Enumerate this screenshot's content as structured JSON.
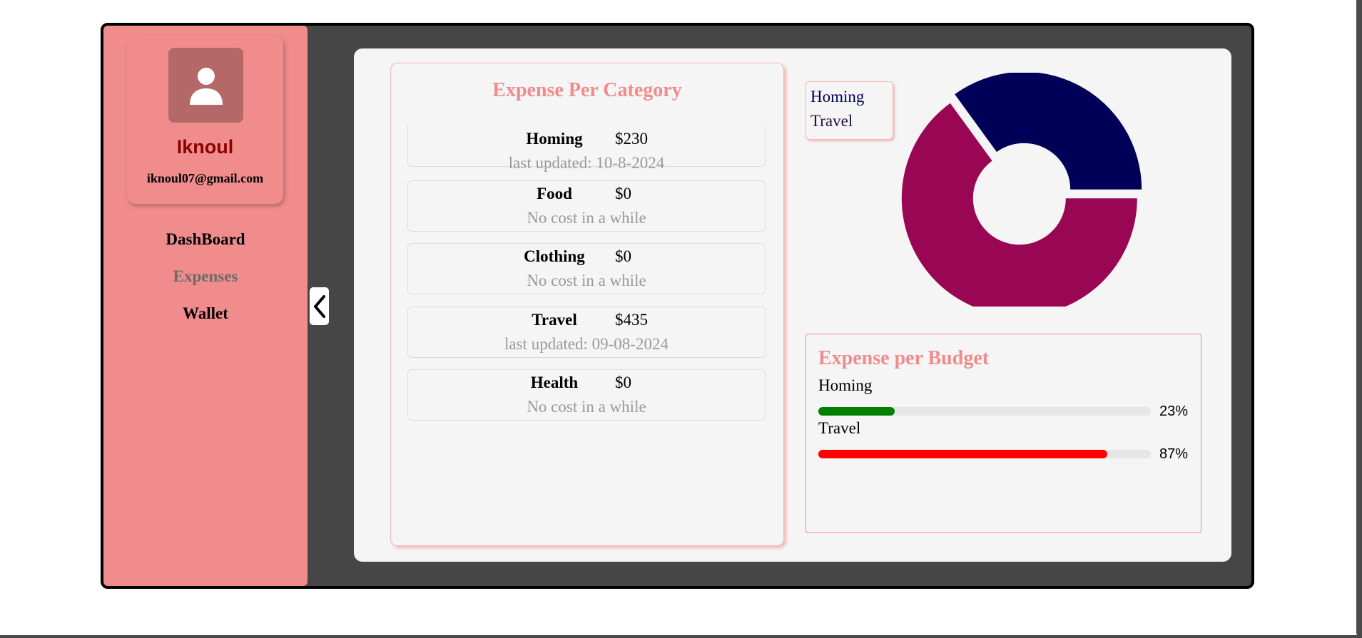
{
  "user": {
    "name": "Iknoul",
    "email": "iknoul07@gmail.com"
  },
  "nav": {
    "items": [
      {
        "label": "DashBoard",
        "active": false
      },
      {
        "label": "Expenses",
        "active": true
      },
      {
        "label": "Wallet",
        "active": false
      }
    ]
  },
  "expense_per_category": {
    "title": "Expense Per Category",
    "items": [
      {
        "name": "Homing",
        "amount": "$230",
        "status": "last updated: 10-8-2024"
      },
      {
        "name": "Food",
        "amount": "$0",
        "status": "No cost in a while"
      },
      {
        "name": "Clothing",
        "amount": "$0",
        "status": "No cost in a while"
      },
      {
        "name": "Travel",
        "amount": "$435",
        "status": "last updated: 09-08-2024"
      },
      {
        "name": "Health",
        "amount": "$0",
        "status": "No cost in a while"
      }
    ]
  },
  "chart_data": {
    "type": "pie",
    "categories": [
      "Homing",
      "Travel"
    ],
    "values": [
      65,
      35
    ],
    "colors": [
      "#990654",
      "#000058"
    ],
    "legend_position": "top-left"
  },
  "expense_per_budget": {
    "title": "Expense per Budget",
    "items": [
      {
        "label": "Homing",
        "percent_label": "23%",
        "fill_fraction": 0.23,
        "color": "#008000"
      },
      {
        "label": "Travel",
        "percent_label": "87%",
        "fill_fraction": 0.87,
        "color": "#ff0000"
      }
    ]
  },
  "icons": {
    "avatar": "user-icon",
    "toggle": "chevron-left-icon"
  }
}
